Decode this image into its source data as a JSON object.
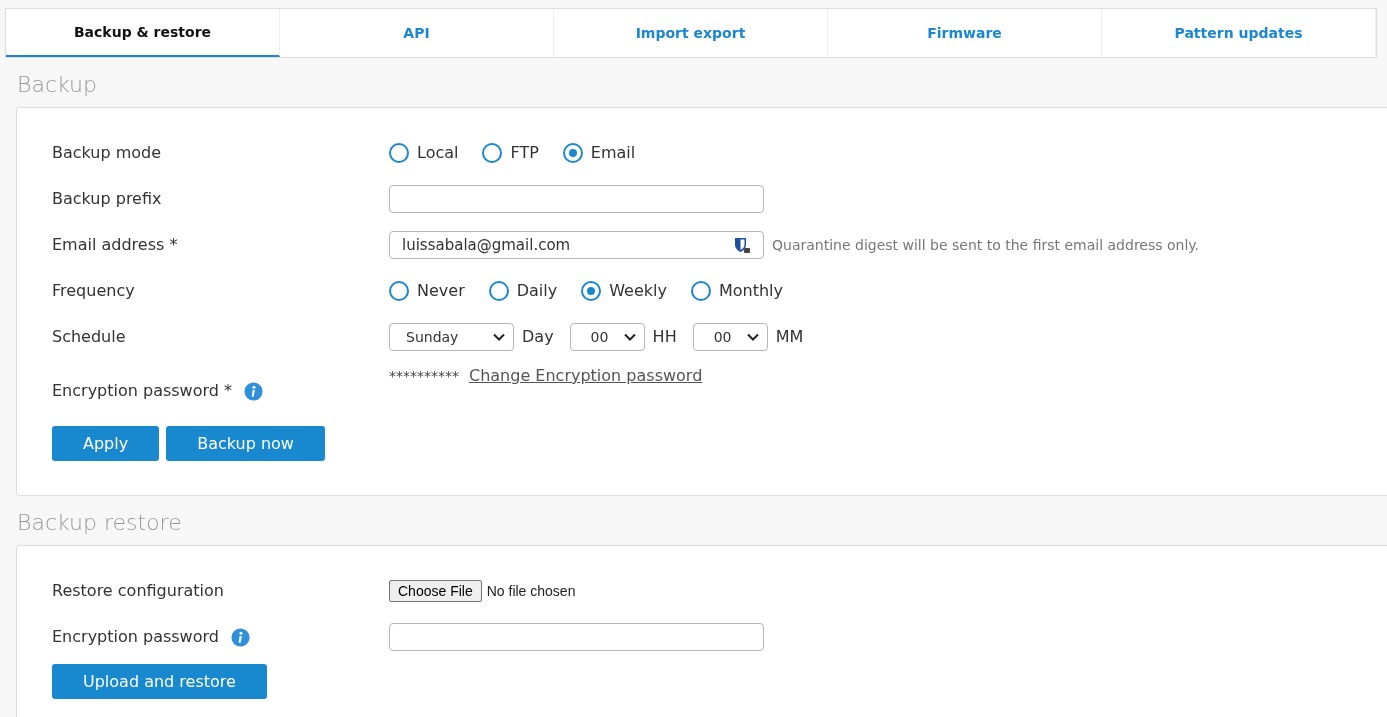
{
  "tabs": [
    {
      "label": "Backup & restore",
      "selected": true
    },
    {
      "label": "API",
      "selected": false
    },
    {
      "label": "Import export",
      "selected": false
    },
    {
      "label": "Firmware",
      "selected": false
    },
    {
      "label": "Pattern updates",
      "selected": false
    }
  ],
  "backup": {
    "title": "Backup",
    "rows": [
      {
        "kind": "radio",
        "label": "Backup mode",
        "options": [
          {
            "label": "Local",
            "selected": false
          },
          {
            "label": "FTP",
            "selected": false
          },
          {
            "label": "Email",
            "selected": true
          }
        ]
      },
      {
        "kind": "text",
        "label": "Backup prefix"
      },
      {
        "kind": "email",
        "label": "Email address *",
        "value": "luissabala@gmail.com",
        "hint": "Quarantine digest will be sent to the first email address only."
      },
      {
        "kind": "radio",
        "label": "Frequency",
        "options": [
          {
            "label": "Never",
            "selected": false
          },
          {
            "label": "Daily",
            "selected": false
          },
          {
            "label": "Weekly",
            "selected": true
          },
          {
            "label": "Monthly",
            "selected": false
          }
        ]
      },
      {
        "kind": "schedule",
        "label": "Schedule",
        "selects": [
          {
            "value": "Sunday",
            "unit": "Day"
          },
          {
            "value": "00",
            "unit": "HH"
          },
          {
            "value": "00",
            "unit": "MM"
          }
        ]
      },
      {
        "kind": "password",
        "label": "Encryption password *",
        "info": true,
        "masked": "**********",
        "link": "Change Encryption password"
      }
    ],
    "buttons": [
      "Apply",
      "Backup now"
    ]
  },
  "restore": {
    "title": "Backup restore",
    "rows": [
      {
        "kind": "file",
        "label": "Restore configuration",
        "button": "Choose File",
        "status": "No file chosen"
      },
      {
        "kind": "text",
        "label": "Encryption password",
        "info": true
      }
    ],
    "buttons": [
      "Upload and restore"
    ]
  }
}
